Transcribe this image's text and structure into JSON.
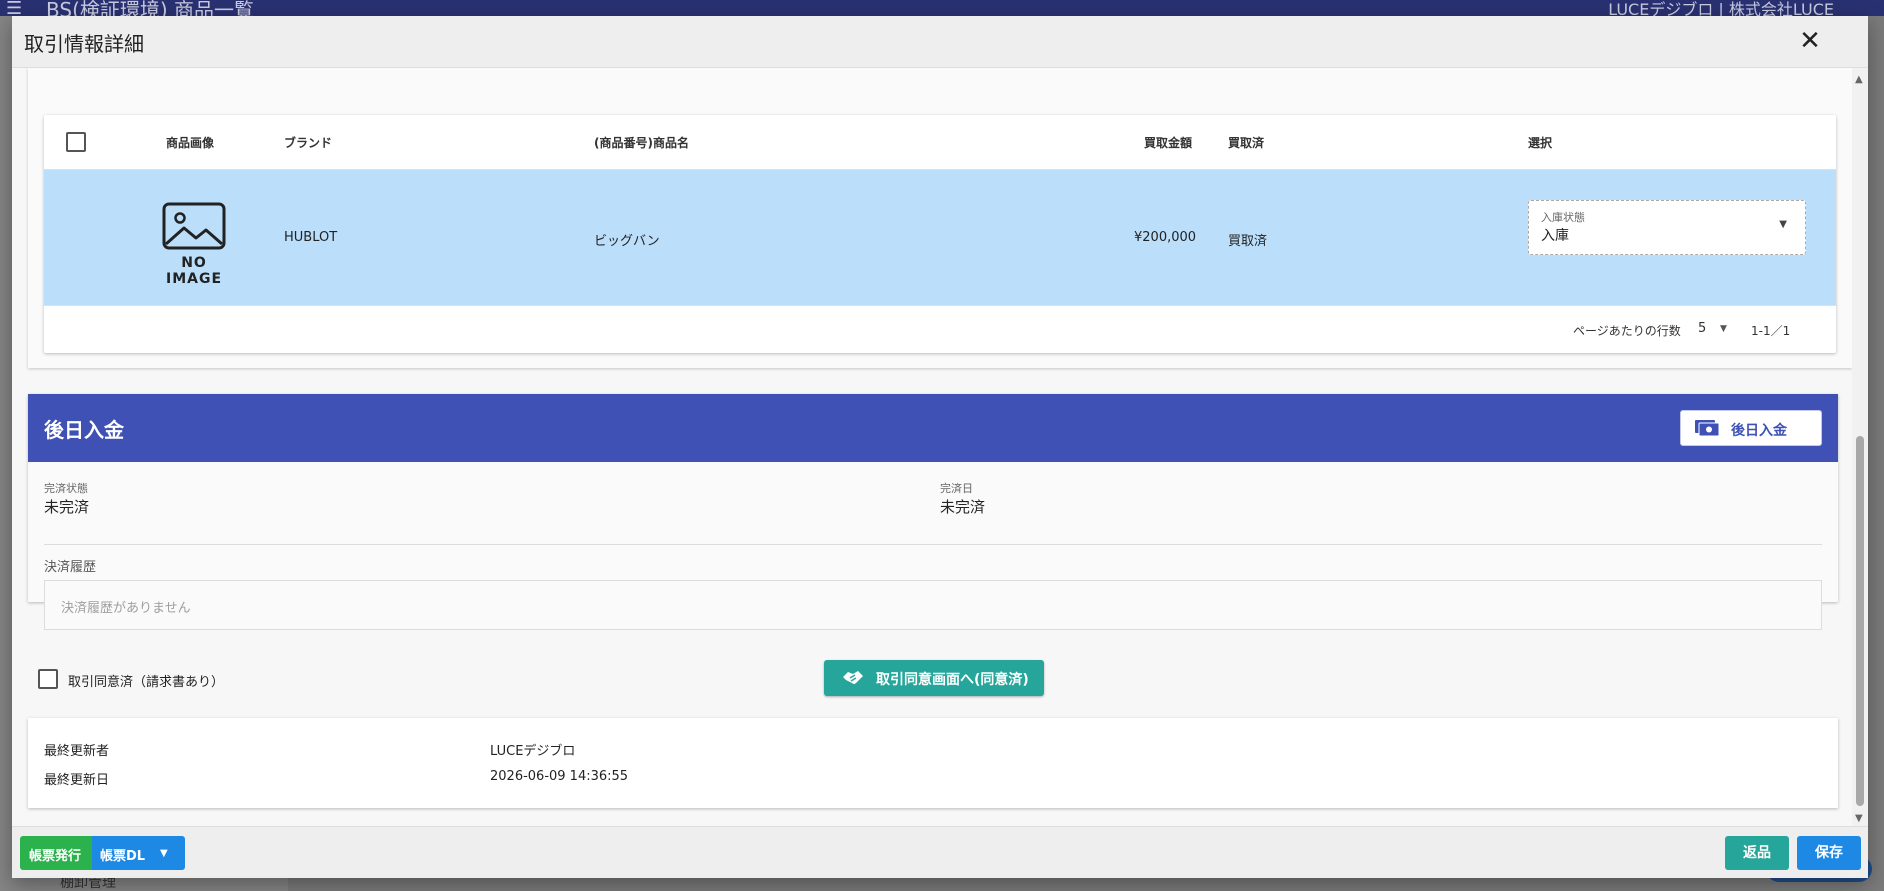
{
  "background": {
    "app_title": "BS(検証環境) 商品一覧",
    "user": "LUCEデジブロ | 株式会社LUCE",
    "side_bottom_label": "棚卸管理"
  },
  "dialog": {
    "title": "取引情報詳細",
    "close_icon": "close-icon"
  },
  "products": {
    "headers": {
      "image": "商品画像",
      "brand": "ブランド",
      "name": "(商品番号)商品名",
      "price": "買取金額",
      "status": "買取済",
      "select": "選択"
    },
    "rows": [
      {
        "no_image": "NO IMAGE",
        "brand": "HUBLOT",
        "name": "ビッグバン",
        "price": "¥200,000",
        "status": "買取済",
        "select_label": "入庫状態",
        "select_value": "入庫"
      }
    ],
    "pager": {
      "rows_label": "ページあたりの行数",
      "rows_value": "5",
      "range": "1-1／1"
    }
  },
  "deposit": {
    "title": "後日入金",
    "button_label": "後日入金",
    "completion_status_label": "完済状態",
    "completion_status_value": "未完済",
    "completion_date_label": "完済日",
    "completion_date_value": "未完済",
    "history_label": "決済履歴",
    "history_empty": "決済履歴がありません"
  },
  "agreement": {
    "checkbox_label": "取引同意済（請求書あり）",
    "button_label": "取引同意画面へ(同意済)"
  },
  "audit": {
    "updated_by_label": "最終更新者",
    "updated_by_value": "LUCEデジブロ",
    "updated_at_label": "最終更新日",
    "updated_at_value": "2026-06-09 14:36:55"
  },
  "footer": {
    "issue_label": "帳票発行",
    "download_label": "帳票DL",
    "return_label": "返品",
    "save_label": "保存"
  },
  "colors": {
    "deposit_header": "#3f51b5",
    "selected_row": "#bbdefb",
    "teal": "#26a69a",
    "blue": "#1e88e5",
    "green": "#2bb24c"
  }
}
